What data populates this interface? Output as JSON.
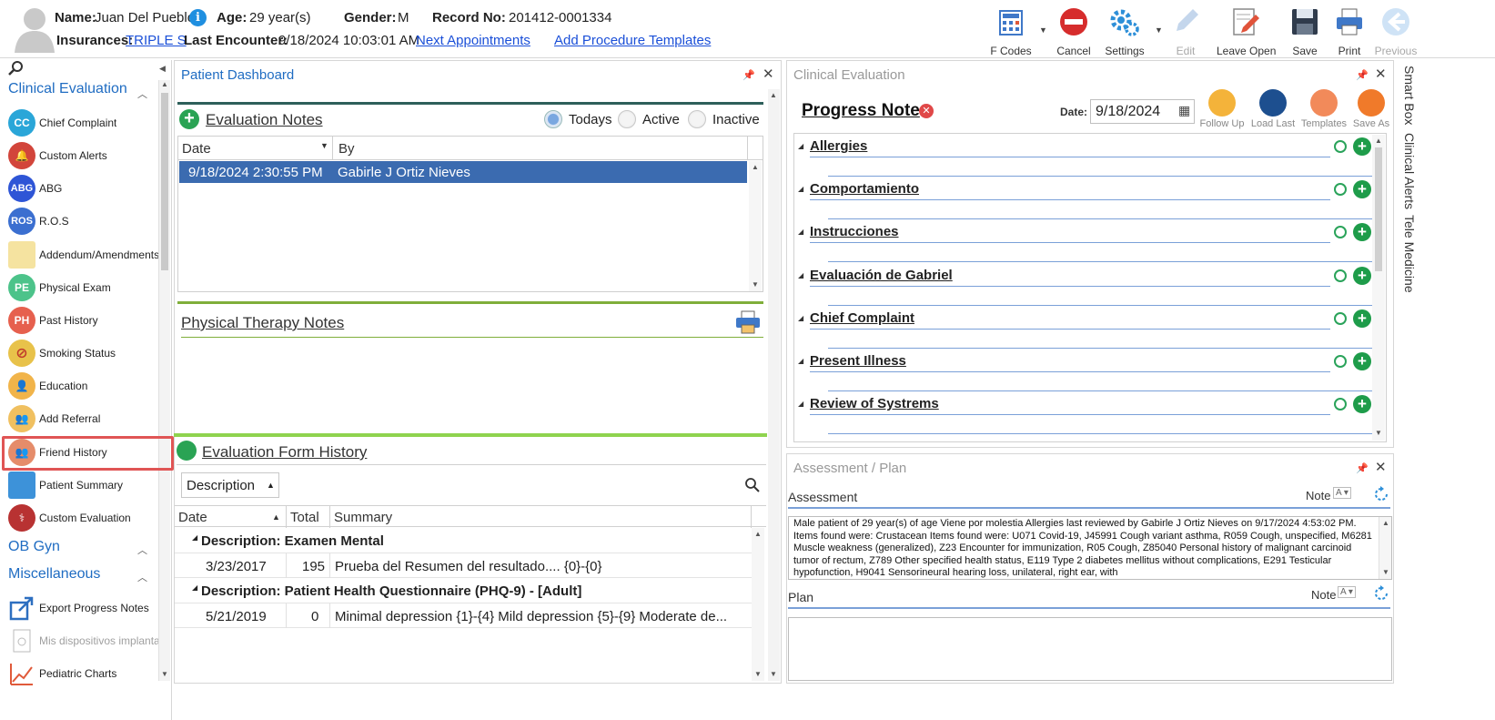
{
  "patient": {
    "name_label": "Name:",
    "name": "Juan Del Pueblo",
    "age_label": "Age:",
    "age": "29 year(s)",
    "gender_label": "Gender:",
    "gender": "M",
    "record_label": "Record No:",
    "record": "201412-0001334",
    "insurances_label": "Insurances:",
    "insurance": "TRIPLE S",
    "last_encounter_label": "Last Encounter:",
    "last_encounter": "9/18/2024 10:03:01 AM",
    "next_appointments": "Next Appointments",
    "add_procedure_templates": "Add Procedure Templates"
  },
  "toolbar": {
    "fcodes": "F Codes",
    "cancel": "Cancel",
    "settings": "Settings",
    "edit": "Edit",
    "leave_open": "Leave Open",
    "save": "Save",
    "print": "Print",
    "previous": "Previous"
  },
  "sidebar": {
    "section_clinical": "Clinical Evaluation",
    "section_obgyn": "OB Gyn",
    "section_misc": "Miscellaneous",
    "items": [
      {
        "label": "Chief Complaint",
        "abbr": "CC",
        "color": "#2aa6d8"
      },
      {
        "label": "Custom Alerts",
        "abbr": "",
        "color": "#d2453b"
      },
      {
        "label": "ABG",
        "abbr": "ABG",
        "color": "#2e55d6"
      },
      {
        "label": "R.O.S",
        "abbr": "ROS",
        "color": "#3b6fd0"
      },
      {
        "label": "Addendum/Amendments",
        "abbr": "",
        "color": "#f0d36a"
      },
      {
        "label": "Physical Exam",
        "abbr": "PE",
        "color": "#4cc38a"
      },
      {
        "label": "Past History",
        "abbr": "PH",
        "color": "#e6604e"
      },
      {
        "label": "Smoking Status",
        "abbr": "",
        "color": "#e8c24a"
      },
      {
        "label": "Education",
        "abbr": "",
        "color": "#f1b44a"
      },
      {
        "label": "Add Referral",
        "abbr": "",
        "color": "#f0c060"
      },
      {
        "label": "Friend History",
        "abbr": "",
        "color": "#e58c6a"
      },
      {
        "label": "Patient Summary",
        "abbr": "",
        "color": "#3d92d9"
      },
      {
        "label": "Custom Evaluation",
        "abbr": "",
        "color": "#b83232"
      }
    ],
    "misc_items": [
      {
        "label": "Export Progress Notes"
      },
      {
        "label": "Mis dispositivos implanta"
      },
      {
        "label": "Pediatric Charts"
      }
    ]
  },
  "dashboard": {
    "title": "Patient Dashboard",
    "eval_notes_title": "Evaluation Notes",
    "filter_todays": "Todays",
    "filter_active": "Active",
    "filter_inactive": "Inactive",
    "col_date": "Date",
    "col_by": "By",
    "rows": [
      {
        "date": "9/18/2024 2:30:55 PM",
        "by": "Gabirle J Ortiz Nieves"
      }
    ],
    "pt_notes_title": "Physical Therapy Notes",
    "form_history_title": "Evaluation Form History",
    "group_by": "Description",
    "fh_col_date": "Date",
    "fh_col_total": "Total",
    "fh_col_summary": "Summary",
    "groups": [
      {
        "header": "Description: Examen Mental",
        "date": "3/23/2017",
        "total": "195",
        "summary": "Prueba del Resumen del resultado.... {0}-{0}"
      },
      {
        "header": "Description: Patient Health Questionnaire (PHQ-9) - [Adult]",
        "date": "5/21/2019",
        "total": "0",
        "summary": "Minimal depression {1}-{4}  Mild depression {5}-{9}  Moderate de..."
      }
    ]
  },
  "clinical": {
    "title": "Clinical Evaluation",
    "note_title": "Progress Note",
    "date_label": "Date:",
    "date_value": "9/18/2024",
    "tools": [
      "Follow Up",
      "Load Last",
      "Templates",
      "Save As"
    ],
    "sections": [
      "Allergies",
      "Comportamiento",
      "Instrucciones",
      "Evaluación de Gabriel",
      "Chief Complaint",
      "Present Illness",
      "Review of Systrems"
    ]
  },
  "assessment": {
    "title": "Assessment / Plan",
    "assessment_label": "Assessment",
    "note_label": "Note",
    "text": "Male patient of 29 year(s) of age Viene por molestia     Allergies last reviewed by Gabirle J Ortiz Nieves on 9/17/2024 4:53:02 PM.    Items found were:  Crustacean  Items found were:  U071 Covid-19, J45991 Cough variant asthma, R059 Cough, unspecified, M6281 Muscle weakness (generalized), Z23 Encounter for immunization, R05 Cough, Z85040 Personal history of malignant carcinoid tumor of rectum, Z789 Other specified health status, E119 Type 2 diabetes mellitus without complications, E291 Testicular hypofunction, H9041 Sensorineural hearing loss, unilateral, right ear, with",
    "plan_label": "Plan"
  },
  "right_tabs": [
    "Smart Box",
    "Clinical Alerts",
    "Tele Medicine"
  ]
}
